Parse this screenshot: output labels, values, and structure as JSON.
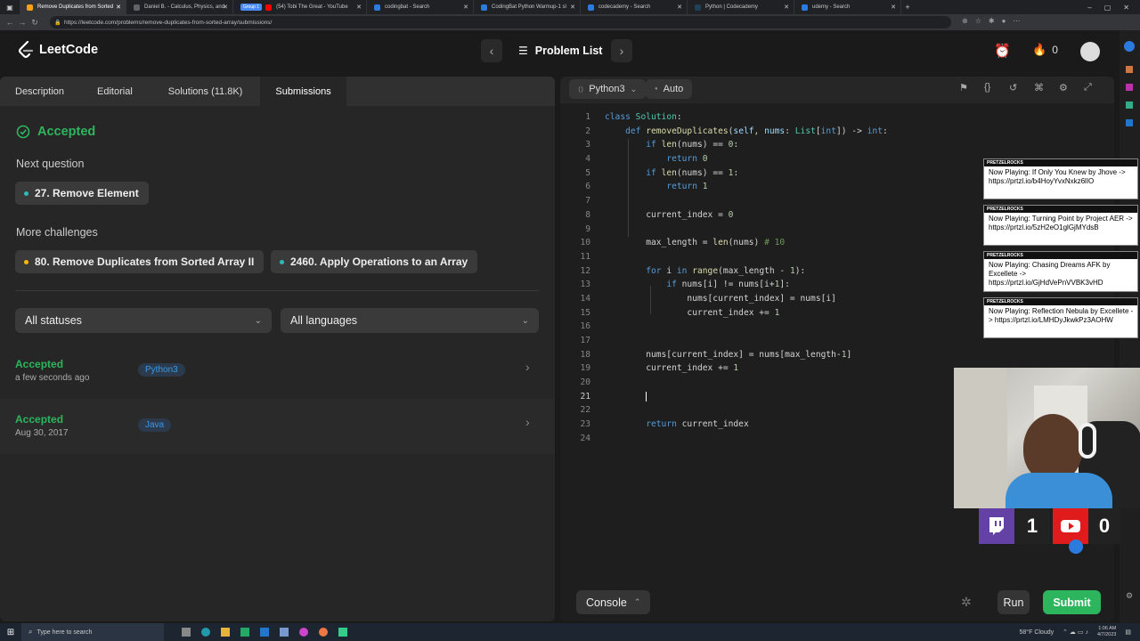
{
  "browser": {
    "tabs": [
      {
        "label": "Remove Duplicates from Sorted",
        "active": true,
        "color": "#ffa116"
      },
      {
        "label": "Daniel B. - Calculus, Physics, and",
        "color": "#5f6368"
      },
      {
        "label": "(54) Tobi The Great - YouTube",
        "group": "Group 1",
        "color": "#ff0000"
      },
      {
        "label": "codingbat - Search",
        "color": "#2b7bde"
      },
      {
        "label": "CodingBat Python Warmup-1 sl",
        "color": "#2b7bde"
      },
      {
        "label": "codecademy - Search",
        "color": "#2b7bde"
      },
      {
        "label": "Python | Codecademy",
        "color": "#1f4056"
      },
      {
        "label": "udemy - Search",
        "color": "#2b7bde"
      }
    ],
    "url": "https://leetcode.com/problems/remove-duplicates-from-sorted-array/submissions/"
  },
  "header": {
    "logo": "LeetCode",
    "problem_list": "Problem List",
    "fire_count": "0"
  },
  "left": {
    "tabs": [
      "Description",
      "Editorial",
      "Solutions (11.8K)",
      "Submissions"
    ],
    "status": "Accepted",
    "next_question_label": "Next question",
    "next_question": "27. Remove Element",
    "more_challenges_label": "More challenges",
    "challenges": [
      "80. Remove Duplicates from Sorted Array II",
      "2460. Apply Operations to an Array"
    ],
    "filter_status": "All statuses",
    "filter_language": "All languages",
    "submissions": [
      {
        "status": "Accepted",
        "time": "a few seconds ago",
        "lang": "Python3"
      },
      {
        "status": "Accepted",
        "time": "Aug 30, 2017",
        "lang": "Java"
      }
    ]
  },
  "editor": {
    "language": "Python3",
    "mode": "Auto",
    "console": "Console",
    "run": "Run",
    "submit": "Submit"
  },
  "stream": {
    "np_header": "PRETZELROCKS",
    "now_playing": [
      "Now Playing: If Only You Knew by Jhove -> https://prtzl.io/b4HoyYvxNxkz6lIO",
      "Now Playing: Turning Point by Project AER -> https://prtzl.io/5zH2eO1glGjMYdsB",
      "Now Playing: Chasing Dreams AFK by Excellete -> https://prtzl.io/GjHdVePnVVBK3vHD",
      "Now Playing: Reflection Nebula by Excellete -> https://prtzl.io/LMHDyJkwkPz3AOHW"
    ],
    "twitch_count": "1",
    "youtube_count": "0"
  },
  "taskbar": {
    "search": "Type here to search",
    "weather": "58°F Cloudy",
    "time": "1:06 AM",
    "date": "4/7/2023"
  }
}
